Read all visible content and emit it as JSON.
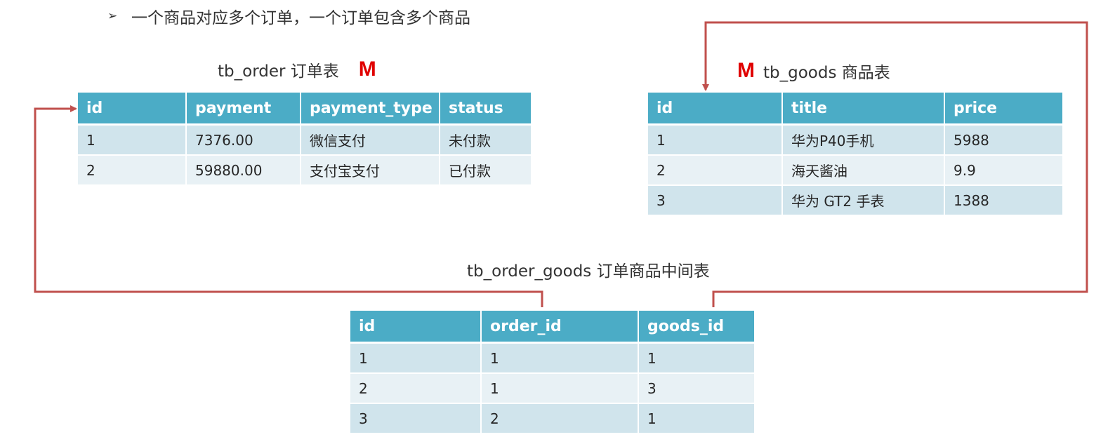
{
  "heading": {
    "bullet_icon": "arrowhead-bullet-icon",
    "text": "一个商品对应多个订单，一个订单包含多个商品"
  },
  "order_table": {
    "caption": "tb_order 订单表",
    "mark": "M",
    "columns": [
      "id",
      "payment",
      "payment_type",
      "status"
    ],
    "rows": [
      [
        "1",
        "7376.00",
        "微信支付",
        "未付款"
      ],
      [
        "2",
        "59880.00",
        "支付宝支付",
        "已付款"
      ]
    ]
  },
  "goods_table": {
    "caption": "tb_goods 商品表",
    "mark": "M",
    "columns": [
      "id",
      "title",
      "price"
    ],
    "rows": [
      [
        "1",
        "华为P40手机",
        "5988"
      ],
      [
        "2",
        "海天酱油",
        "9.9"
      ],
      [
        "3",
        "华为 GT2 手表",
        "1388"
      ]
    ]
  },
  "order_goods_table": {
    "caption": "tb_order_goods 订单商品中间表",
    "columns": [
      "id",
      "order_id",
      "goods_id"
    ],
    "rows": [
      [
        "1",
        "1",
        "1"
      ],
      [
        "2",
        "1",
        "3"
      ],
      [
        "3",
        "2",
        "1"
      ]
    ]
  },
  "colors": {
    "header_bg": "#4bacc6",
    "row_odd": "#d0e4ec",
    "row_even": "#e8f1f5",
    "link_arrow": "#c0504d",
    "mark": "#e00000"
  }
}
